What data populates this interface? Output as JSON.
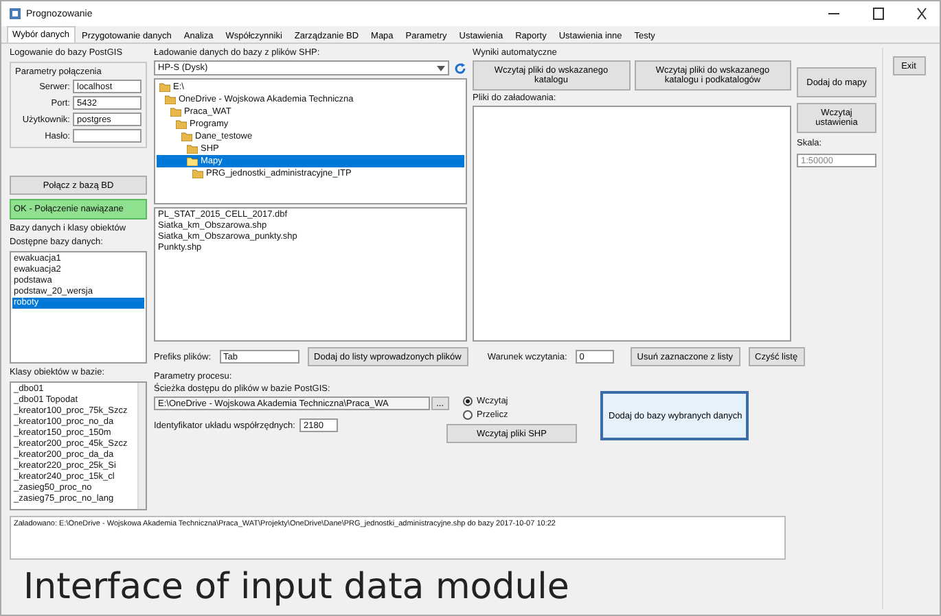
{
  "window": {
    "title": "Prognozowanie"
  },
  "tabs": [
    {
      "label": "Wybór danych",
      "selected": true
    },
    {
      "label": "Przygotowanie danych",
      "selected": false
    },
    {
      "label": "Analiza",
      "selected": false
    },
    {
      "label": "Współczynniki",
      "selected": false
    },
    {
      "label": "Zarządzanie BD",
      "selected": false
    },
    {
      "label": "Mapa",
      "selected": false
    },
    {
      "label": "Parametry",
      "selected": false
    },
    {
      "label": "Ustawienia",
      "selected": false
    },
    {
      "label": "Raporty",
      "selected": false
    },
    {
      "label": "Ustawienia inne",
      "selected": false
    },
    {
      "label": "Testy",
      "selected": false
    }
  ],
  "login": {
    "title": "Logowanie do bazy PostGIS",
    "group": "Parametry połączenia",
    "fields": [
      {
        "label": "Serwer:",
        "value": "localhost"
      },
      {
        "label": "Port:",
        "value": "5432"
      },
      {
        "label": "Użytkownik:",
        "value": "postgres"
      },
      {
        "label": "Hasło:"
      }
    ],
    "button": "Połącz z bazą BD",
    "status": "OK - Połączenie nawiązane"
  },
  "databases": {
    "title": "Bazy danych i klasy obiektów",
    "label": "Dostępne bazy danych:",
    "items": [
      {
        "label": "ewakuacja1",
        "selected": false
      },
      {
        "label": "ewakuacja2",
        "selected": false
      },
      {
        "label": "podstawa",
        "selected": false
      },
      {
        "label": "podstaw_20_wersja",
        "selected": false
      },
      {
        "label": "roboty",
        "selected": true
      }
    ]
  },
  "classes": {
    "label": "Klasy obiektów w bazie:",
    "items": [
      {
        "label": "_dbo01",
        "selected": false
      },
      {
        "label": "_dbo01 Topodat",
        "selected": false
      },
      {
        "label": "_kreator100_proc_75k_Szcz",
        "selected": false
      },
      {
        "label": "_kreator100_proc_no_da",
        "selected": false
      },
      {
        "label": "_kreator150_proc_150m",
        "selected": false
      },
      {
        "label": "_kreator200_proc_45k_Szcz",
        "selected": false
      },
      {
        "label": "_kreator200_proc_da_da",
        "selected": false
      },
      {
        "label": "_kreator220_proc_25k_Si",
        "selected": false
      },
      {
        "label": "_kreator240_proc_15k_cl",
        "selected": false
      },
      {
        "label": "_zasieg50_proc_no",
        "selected": false
      },
      {
        "label": "_zasieg75_proc_no_lang",
        "selected": false
      }
    ]
  },
  "loader": {
    "title": "Ładowanie danych do bazy z plików SHP:",
    "drive": "HP-S (Dysk)",
    "tree": [
      {
        "label": "E:\\",
        "selected": false,
        "children": [
          {
            "label": "OneDrive - Wojskowa Akademia Techniczna",
            "selected": false,
            "children": [
              {
                "label": "Praca_WAT",
                "selected": false,
                "children": [
                  {
                    "label": "Programy",
                    "selected": false,
                    "children": [
                      {
                        "label": "Dane_testowe",
                        "selected": false,
                        "children": [
                          {
                            "label": "SHP",
                            "selected": false
                          },
                          {
                            "label": "Mapy",
                            "selected": true,
                            "children": [
                              {
                                "label": "PRG_jednostki_administracyjne_ITP",
                                "selected": false
                              }
                            ]
                          }
                        ]
                      }
                    ]
                  }
                ]
              }
            ]
          }
        ]
      }
    ],
    "files": [
      {
        "label": "PL_STAT_2015_CELL_2017.dbf",
        "selected": false
      },
      {
        "label": "Siatka_km_Obszarowa.shp",
        "selected": false
      },
      {
        "label": "Siatka_km_Obszarowa_punkty.shp",
        "selected": false
      },
      {
        "label": "Punkty.shp",
        "selected": false
      }
    ]
  },
  "prefix": {
    "label": "Prefiks plików:",
    "value": "Tab"
  },
  "add_button": "Dodaj do listy wprowadzonych plików",
  "process": {
    "title": "Parametry procesu:",
    "path_label": "Ścieżka dostępu do plików w bazie PostGIS:",
    "path": "E:\\OneDrive - Wojskowa Akademia Techniczna\\Praca_WA",
    "browse": "...",
    "srid_label": "Identyfikator układu współrzędnych:",
    "srid": "2180"
  },
  "mode": [
    {
      "label": "Wczytaj",
      "selected": true
    },
    {
      "label": "Przelicz",
      "selected": false
    }
  ],
  "load_button": "Wczytaj pliki SHP",
  "auto": {
    "title": "Wyniki automatyczne",
    "buttons": [
      "Wczytaj pliki do wskazanego katalogu",
      "Wczytaj pliki do wskazanego katalogu i podkatalogów"
    ]
  },
  "queue": {
    "label": "Pliki do załadowania:"
  },
  "condition": {
    "label": "Warunek wczytania:",
    "value": "0"
  },
  "queue_buttons": [
    "Usuń zaznaczone z listy",
    "Czyść listę"
  ],
  "import_button": "Dodaj do bazy wybranych danych",
  "side": {
    "buttons": [
      "Dodaj do mapy",
      "Wczytaj ustawienia"
    ],
    "scale_label": "Skala:",
    "scale_placeholder": "1:50000"
  },
  "exit": "Exit",
  "log": "Załadowano: E:\\OneDrive - Wojskowa Akademia Techniczna\\Praca_WAT\\Projekty\\OneDrive\\Dane\\PRG_jednostki_administracyjne.shp do bazy 2017-10-07 10:22",
  "caption": "Interface of input data module"
}
